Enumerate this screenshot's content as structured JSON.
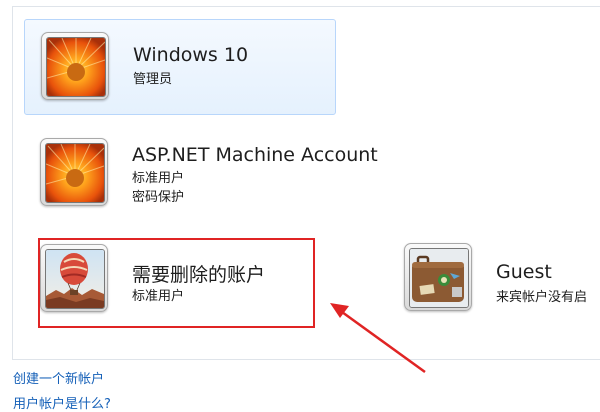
{
  "accounts": [
    {
      "name": "Windows 10",
      "details": [
        "管理员"
      ],
      "picture": "flower-picture",
      "selected": true
    },
    {
      "name": "ASP.NET Machine Account",
      "details": [
        "标准用户",
        "密码保护"
      ],
      "picture": "flower-picture",
      "selected": false
    },
    {
      "name": "需要删除的账户",
      "details": [
        "标准用户"
      ],
      "picture": "hot-air-balloon-picture",
      "selected": false
    },
    {
      "name": "Guest",
      "details": [
        "来宾帐户没有启"
      ],
      "picture": "suitcase-picture",
      "selected": false
    }
  ],
  "links": {
    "create_account": "创建一个新帐户",
    "partial_link": "用户帐户是什么?"
  },
  "colors": {
    "highlight_box": "#e02424",
    "annotation_arrow": "#e02424",
    "link": "#1560b8",
    "selection_border": "#b8d6fb"
  }
}
